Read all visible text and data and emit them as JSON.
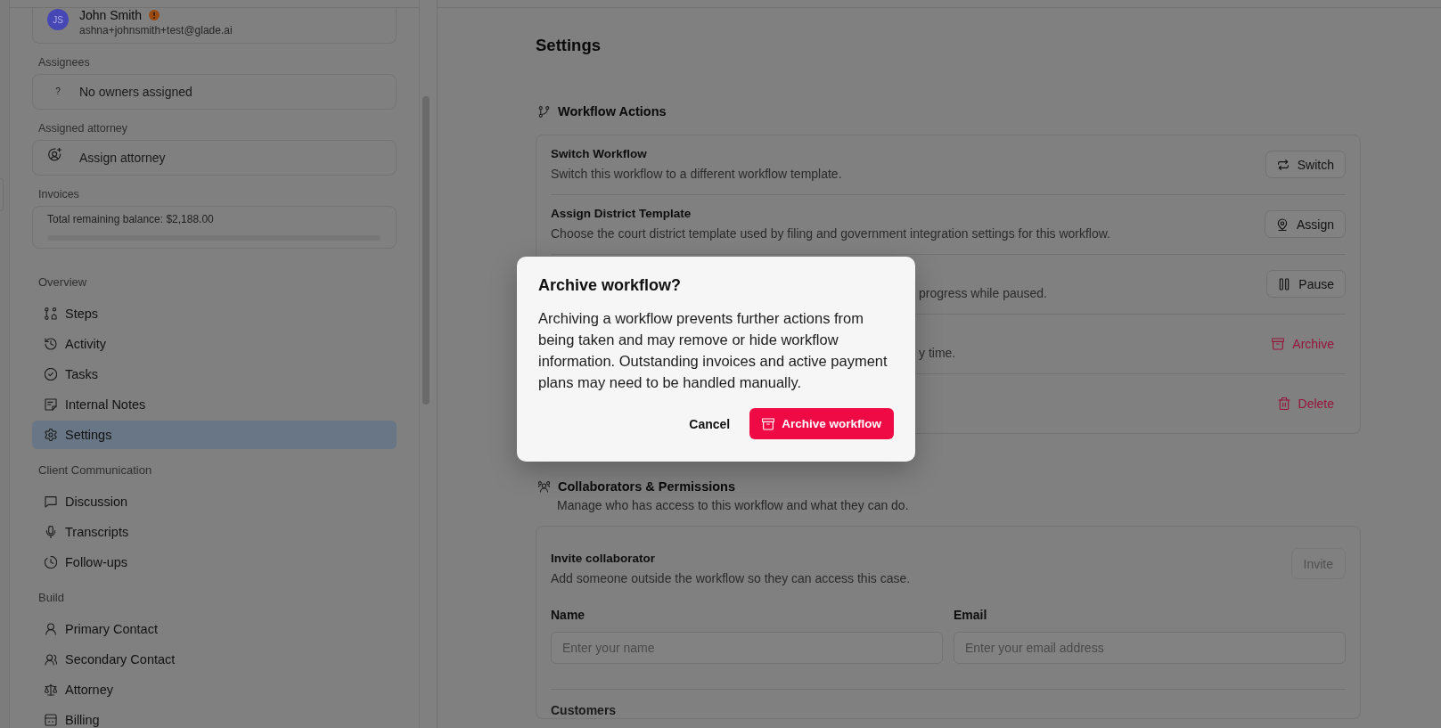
{
  "sidebar": {
    "contact": {
      "initials": "JS",
      "name": "John Smith",
      "warning": true,
      "email": "ashna+johnsmith+test@glade.ai"
    },
    "fields": [
      {
        "label": "Assignees",
        "kind": "owners",
        "symbol": "?",
        "value": "No owners assigned"
      },
      {
        "label": "Assigned attorney",
        "kind": "attorney",
        "value": "Assign attorney"
      }
    ],
    "invoices": {
      "label": "Invoices",
      "balance": "Total remaining balance: $2,188.00",
      "level": 0
    },
    "sections": [
      {
        "title": "Overview",
        "items": [
          {
            "label": "Steps",
            "kind": "steps",
            "selected": false
          },
          {
            "label": "Activity",
            "kind": "activity",
            "selected": false
          },
          {
            "label": "Tasks",
            "kind": "tasks",
            "selected": false
          },
          {
            "label": "Internal Notes",
            "kind": "notes",
            "selected": false
          },
          {
            "label": "Settings",
            "kind": "settings",
            "selected": true
          }
        ]
      },
      {
        "title": "Client Communication",
        "items": [
          {
            "label": "Discussion",
            "kind": "discussion",
            "selected": false
          },
          {
            "label": "Transcripts",
            "kind": "transcripts",
            "selected": false
          },
          {
            "label": "Follow-ups",
            "kind": "followups",
            "selected": false
          }
        ]
      },
      {
        "title": "Build",
        "items": [
          {
            "label": "Primary Contact",
            "kind": "primary_contact",
            "selected": false
          },
          {
            "label": "Secondary Contact",
            "kind": "secondary_contact",
            "selected": false
          },
          {
            "label": "Attorney",
            "kind": "attorney",
            "selected": false
          },
          {
            "label": "Billing",
            "kind": "billing",
            "selected": false
          }
        ]
      }
    ]
  },
  "main": {
    "title": "Settings",
    "workflow_actions": {
      "title": "Workflow Actions",
      "rows": [
        {
          "title": "Switch Workflow",
          "description": "Switch this workflow to a different workflow template.",
          "button": {
            "label": "Switch",
            "kind": "switch"
          }
        },
        {
          "title": "Assign District Template",
          "description": "Choose the court district template used by filing and government integration settings for this workflow.",
          "button": {
            "label": "Assign",
            "kind": "assign"
          }
        },
        {
          "description": "progress while paused.",
          "button": {
            "label": "Pause",
            "kind": "pause"
          }
        },
        {
          "description": "y time.",
          "button": {
            "label": "Archive",
            "kind": "archive"
          }
        },
        {
          "button": {
            "label": "Delete",
            "kind": "delete"
          }
        }
      ]
    },
    "collaborators": {
      "title": "Collaborators & Permissions",
      "subtitle": "Manage who has access to this workflow and what they can do.",
      "invite": {
        "title": "Invite collaborator",
        "description": "Add someone outside the workflow so they can access this case.",
        "button": {
          "label": "Invite",
          "disabled": true
        }
      },
      "fields": [
        {
          "label": "Name",
          "placeholder": "Enter your name"
        },
        {
          "label": "Email",
          "placeholder": "Enter your email address"
        }
      ],
      "customers_label": "Customers"
    }
  },
  "dialog": {
    "title": "Archive workflow?",
    "body": "Archiving a workflow prevents further actions from being taken and may remove or hide workflow information. Outstanding invoices and active payment plans may need to be handled manually.",
    "cancel": "Cancel",
    "confirm": "Archive workflow"
  }
}
